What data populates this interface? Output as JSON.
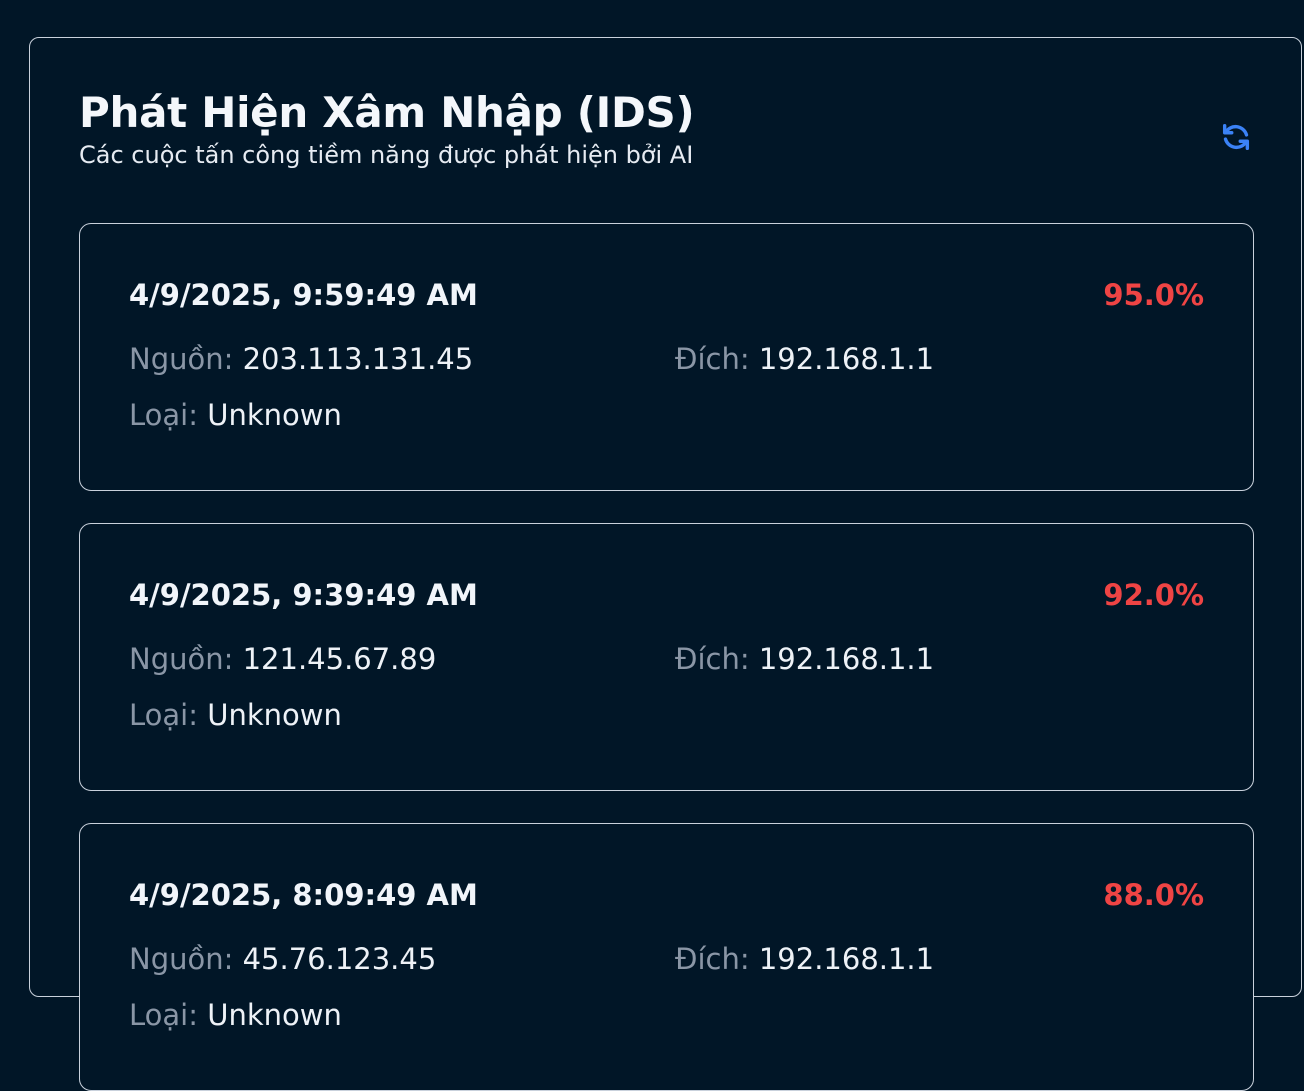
{
  "header": {
    "title": "Phát Hiện Xâm Nhập (IDS)",
    "subtitle": "Các cuộc tấn công tiềm năng được phát hiện bởi AI",
    "refresh_icon": "refresh-icon"
  },
  "labels": {
    "source": "Nguồn:",
    "destination": "Đích:",
    "type": "Loại:"
  },
  "colors": {
    "background": "#011627",
    "border": "#c9d1dc",
    "score": "#ef4444",
    "accent": "#3b82f6"
  },
  "alerts": [
    {
      "time": "4/9/2025, 9:59:49 AM",
      "score": "95.0%",
      "source": "203.113.131.45",
      "destination": "192.168.1.1",
      "type": "Unknown"
    },
    {
      "time": "4/9/2025, 9:39:49 AM",
      "score": "92.0%",
      "source": "121.45.67.89",
      "destination": "192.168.1.1",
      "type": "Unknown"
    },
    {
      "time": "4/9/2025, 8:09:49 AM",
      "score": "88.0%",
      "source": "45.76.123.45",
      "destination": "192.168.1.1",
      "type": "Unknown"
    }
  ]
}
